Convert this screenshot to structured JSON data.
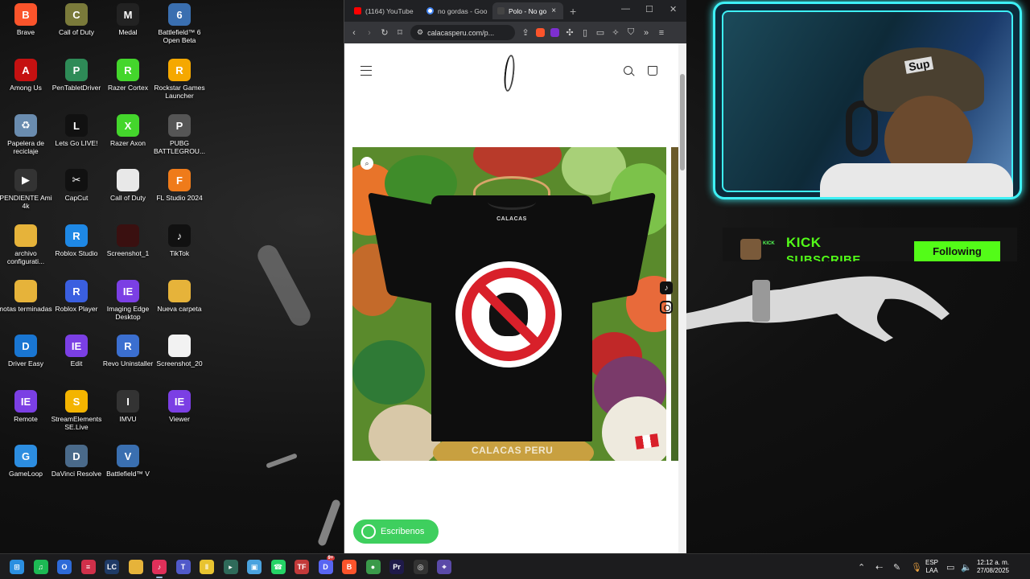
{
  "desktop": {
    "icons": [
      {
        "label": "Brave",
        "icon": "brave-icon",
        "color": "#fb542b",
        "glyph": "B"
      },
      {
        "label": "Call of Duty",
        "icon": "call-of-duty-icon",
        "color": "#7a7a3a",
        "glyph": "C"
      },
      {
        "label": "Medal",
        "icon": "medal-icon",
        "color": "#222222",
        "glyph": "M"
      },
      {
        "label": "Battlefield™ 6 Open Beta",
        "icon": "battlefield-icon",
        "color": "#3a6fb0",
        "glyph": "6"
      },
      {
        "label": "Among Us",
        "icon": "among-us-icon",
        "color": "#c51111",
        "glyph": "A"
      },
      {
        "label": "PenTabletDriver",
        "icon": "pen-tablet-icon",
        "color": "#2e8b57",
        "glyph": "P"
      },
      {
        "label": "Razer Cortex",
        "icon": "razer-cortex-icon",
        "color": "#44d62c",
        "glyph": "R"
      },
      {
        "label": "Rockstar Games Launcher",
        "icon": "rockstar-icon",
        "color": "#f5a800",
        "glyph": "R"
      },
      {
        "label": "Papelera de reciclaje",
        "icon": "recycle-bin-icon",
        "color": "#6a8caf",
        "glyph": "♻"
      },
      {
        "label": "Lets Go LIVE!",
        "icon": "lets-go-live-icon",
        "color": "#111111",
        "glyph": "L"
      },
      {
        "label": "Razer Axon",
        "icon": "razer-axon-icon",
        "color": "#44d62c",
        "glyph": "X"
      },
      {
        "label": "PUBG BATTLEGROU...",
        "icon": "pubg-icon",
        "color": "#555555",
        "glyph": "P"
      },
      {
        "label": "PENDIENTE Ami 4k",
        "icon": "video-file-icon",
        "color": "#333333",
        "glyph": "▶"
      },
      {
        "label": "CapCut",
        "icon": "capcut-icon",
        "color": "#111111",
        "glyph": "✂"
      },
      {
        "label": "Call of Duty",
        "icon": "document-icon",
        "color": "#e8e8e8",
        "glyph": ""
      },
      {
        "label": "FL Studio 2024",
        "icon": "fl-studio-icon",
        "color": "#ef7b1a",
        "glyph": "F"
      },
      {
        "label": "archivo configurati...",
        "icon": "folder-icon",
        "color": "#e6b33a",
        "glyph": ""
      },
      {
        "label": "Roblox Studio",
        "icon": "roblox-studio-icon",
        "color": "#1e88e5",
        "glyph": "R"
      },
      {
        "label": "Screenshot_1",
        "icon": "image-file-icon",
        "color": "#3a1010",
        "glyph": ""
      },
      {
        "label": "TikTok",
        "icon": "tiktok-icon",
        "color": "#111111",
        "glyph": "♪"
      },
      {
        "label": "notas terminadas",
        "icon": "folder-icon",
        "color": "#e6b33a",
        "glyph": ""
      },
      {
        "label": "Roblox Player",
        "icon": "roblox-player-icon",
        "color": "#3a5fe0",
        "glyph": "R"
      },
      {
        "label": "Imaging Edge Desktop",
        "icon": "imaging-edge-icon",
        "color": "#7b3fe4",
        "glyph": "IE"
      },
      {
        "label": "Nueva carpeta",
        "icon": "folder-icon",
        "color": "#e6b33a",
        "glyph": ""
      },
      {
        "label": "Driver Easy",
        "icon": "driver-easy-icon",
        "color": "#1976d2",
        "glyph": "D"
      },
      {
        "label": "Edit",
        "icon": "imaging-edge-edit-icon",
        "color": "#7b3fe4",
        "glyph": "IE"
      },
      {
        "label": "Revo Uninstaller",
        "icon": "revo-uninstaller-icon",
        "color": "#3b6fd0",
        "glyph": "R"
      },
      {
        "label": "Screenshot_20",
        "icon": "image-file-icon",
        "color": "#f2f2f2",
        "glyph": ""
      },
      {
        "label": "Remote",
        "icon": "imaging-edge-remote-icon",
        "color": "#7b3fe4",
        "glyph": "IE"
      },
      {
        "label": "StreamElements SE.Live",
        "icon": "streamelements-icon",
        "color": "#f4b400",
        "glyph": "S"
      },
      {
        "label": "IMVU",
        "icon": "imvu-icon",
        "color": "#333333",
        "glyph": "I"
      },
      {
        "label": "Viewer",
        "icon": "imaging-edge-viewer-icon",
        "color": "#7b3fe4",
        "glyph": "IE"
      },
      {
        "label": "GameLoop",
        "icon": "gameloop-icon",
        "color": "#2c8de0",
        "glyph": "G"
      },
      {
        "label": "DaVinci Resolve",
        "icon": "davinci-resolve-icon",
        "color": "#4a6a8a",
        "glyph": "D"
      },
      {
        "label": "Battlefield™ V",
        "icon": "battlefield-v-icon",
        "color": "#3a6fb0",
        "glyph": "V"
      }
    ]
  },
  "browser": {
    "tabs": [
      {
        "label": "(1164) YouTube",
        "icon": "youtube-icon",
        "color": "#ff0000"
      },
      {
        "label": "no gordas - Goo",
        "icon": "google-icon",
        "color": "#4285f4"
      },
      {
        "label": "Polo - No go",
        "icon": "calacas-favicon-icon",
        "color": "#444444"
      }
    ],
    "new_tab": "+",
    "url": "calacasperu.com/p...",
    "page": {
      "shirt_brand": "CALACAS",
      "watermark": "CALACAS PERU",
      "whatsapp_label": "Escribenos"
    }
  },
  "stream": {
    "kick_small": "KICK",
    "kick_title": "KICK",
    "kick_subtitle": "SUBSCRIBE",
    "follow_label": "Following",
    "cap_logo": "Sup"
  },
  "taskbar": {
    "apps": [
      {
        "name": "windows-start",
        "color": "#2b8fe0",
        "glyph": "⊞"
      },
      {
        "name": "spotify",
        "color": "#1db954",
        "glyph": "♫"
      },
      {
        "name": "app-blue-round",
        "color": "#2d6ad8",
        "glyph": "O"
      },
      {
        "name": "app-red-stripes",
        "color": "#d0304a",
        "glyph": "≡"
      },
      {
        "name": "app-lc",
        "color": "#1f3a66",
        "glyph": "LC"
      },
      {
        "name": "file-explorer",
        "color": "#e6b33a",
        "glyph": ""
      },
      {
        "name": "tiktok-app",
        "color": "#e0305a",
        "glyph": "♪"
      },
      {
        "name": "teams",
        "color": "#5059c9",
        "glyph": "T"
      },
      {
        "name": "app-yellow-bars",
        "color": "#e8c330",
        "glyph": "‖"
      },
      {
        "name": "app-green-arrow",
        "color": "#2f6a5a",
        "glyph": "▸"
      },
      {
        "name": "app-box",
        "color": "#4aa3df",
        "glyph": "▣"
      },
      {
        "name": "whatsapp",
        "color": "#25d366",
        "glyph": "☎"
      },
      {
        "name": "app-tf",
        "color": "#c23a3a",
        "glyph": "TF"
      },
      {
        "name": "discord",
        "color": "#5865f2",
        "glyph": "D"
      },
      {
        "name": "brave",
        "color": "#fb542b",
        "glyph": "B"
      },
      {
        "name": "chrome",
        "color": "#3a9a4a",
        "glyph": "●"
      },
      {
        "name": "premiere-pro",
        "color": "#1f1a4a",
        "glyph": "Pr"
      },
      {
        "name": "obs",
        "color": "#333333",
        "glyph": "◎"
      },
      {
        "name": "gamepad",
        "color": "#5a4aa8",
        "glyph": "⌖"
      }
    ],
    "lang_top": "ESP",
    "lang_bottom": "LAA",
    "time": "12:12 a. m.",
    "date": "27/08/2025",
    "discord_badge": "9+"
  }
}
